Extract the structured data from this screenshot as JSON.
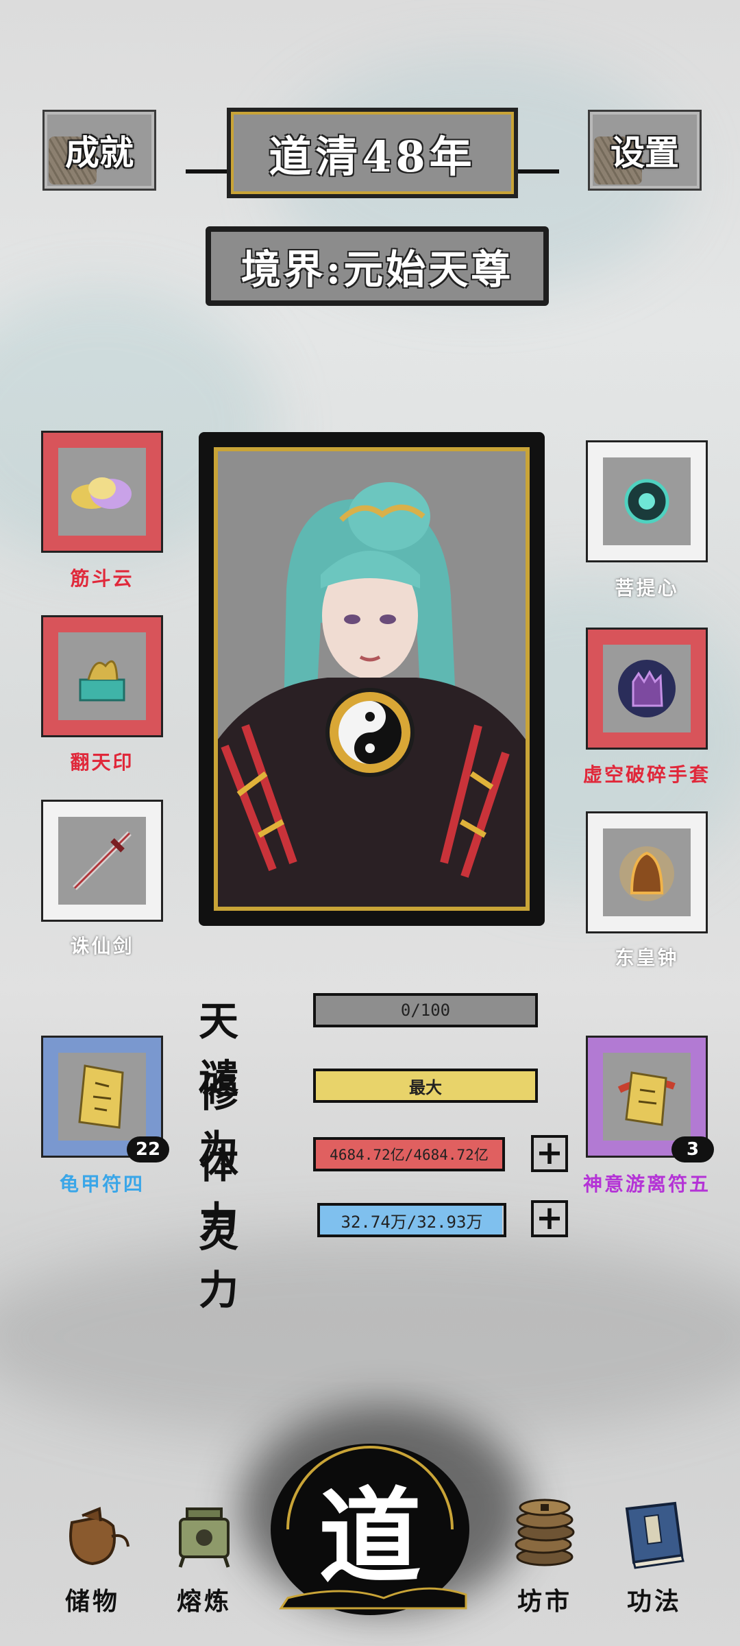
{
  "header": {
    "achievements_label": "成就",
    "settings_label": "设置",
    "year_label": "道清48年",
    "realm_label": "境界:元始天尊"
  },
  "left_items": [
    {
      "name": "筋斗云",
      "label_color": "#e0283a"
    },
    {
      "name": "翻天印",
      "label_color": "#e0283a"
    },
    {
      "name": "诛仙剑",
      "label_color": "#ffffff"
    }
  ],
  "right_items": [
    {
      "name": "菩提心",
      "label_color": "#ffffff"
    },
    {
      "name": "虚空破碎手套",
      "label_color": "#e0283a"
    },
    {
      "name": "东皇钟",
      "label_color": "#ffffff"
    }
  ],
  "talismans": {
    "left": {
      "name": "龟甲符四",
      "count": "22",
      "label_color": "#3aa6e8"
    },
    "right": {
      "name": "神意游离符五",
      "count": "3",
      "label_color": "#b433d6"
    }
  },
  "stats": {
    "tribulation": {
      "label": "天谴",
      "value": "0/100",
      "fill": 0,
      "color": "#8e8e8e"
    },
    "cultivation": {
      "label": "修为",
      "value": "最大",
      "fill": 1,
      "color": "#e8d36a"
    },
    "stamina": {
      "label": "体力",
      "value": "4684.72亿/4684.72亿",
      "fill": 1,
      "color": "#e06060"
    },
    "spirit": {
      "label": "灵力",
      "value": "32.74万/32.93万",
      "fill": 0.994,
      "color": "#7fc0ee"
    }
  },
  "plus_glyph": "+",
  "nav": {
    "storage": "储物",
    "smelt": "熔炼",
    "center": "道",
    "market": "坊市",
    "skills": "功法"
  }
}
